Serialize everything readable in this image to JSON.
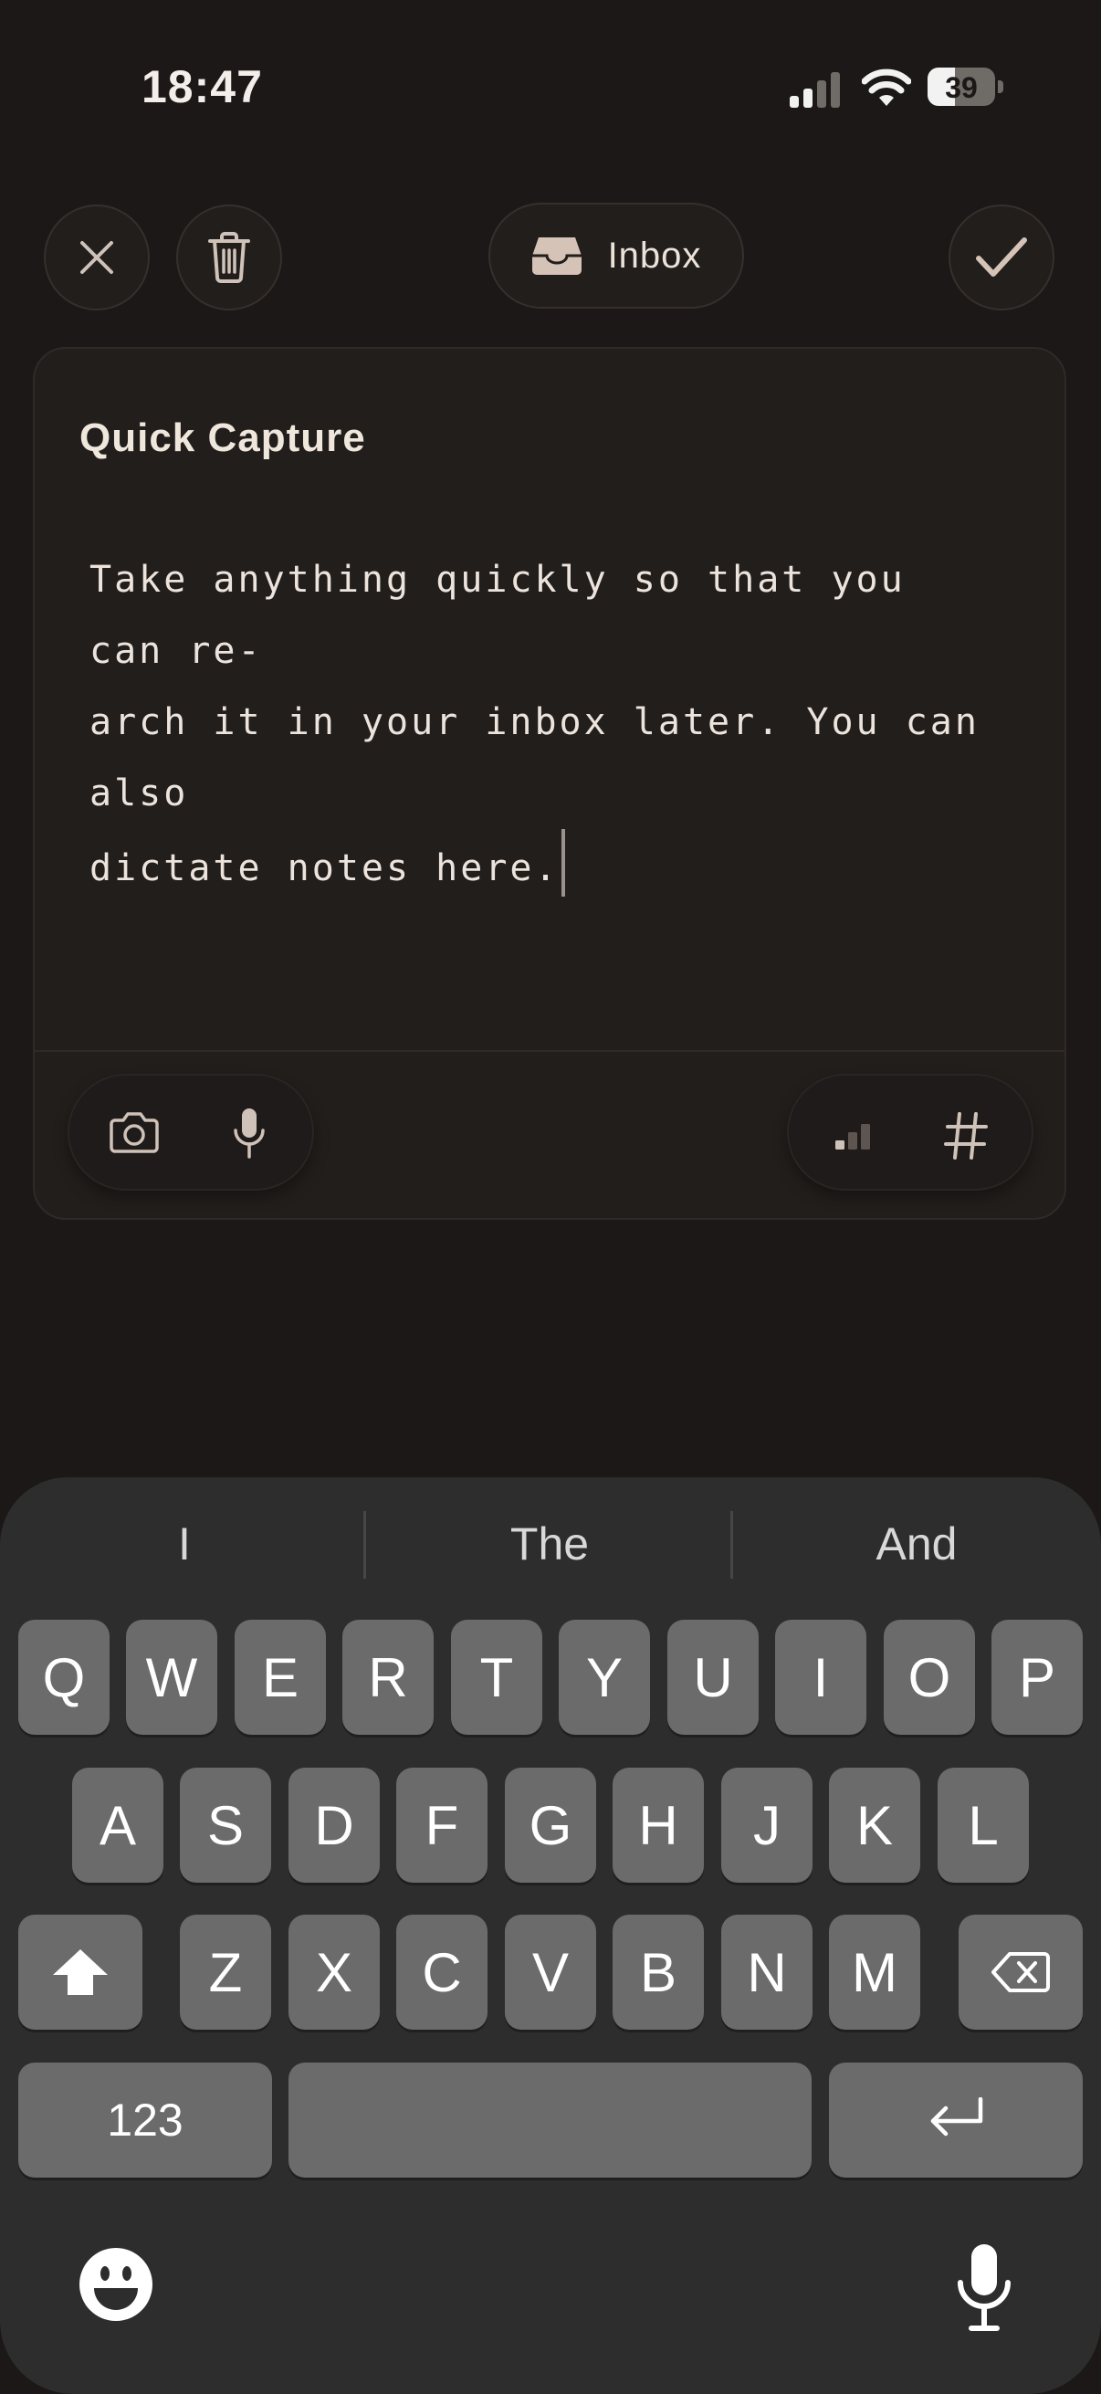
{
  "status_bar": {
    "time": "18:47",
    "battery": "39",
    "icons": [
      "cellular-signal-icon",
      "wifi-icon",
      "battery-icon"
    ]
  },
  "toolbar": {
    "close_icon": "close-icon",
    "delete_icon": "trash-icon",
    "destination_label": "Inbox",
    "destination_icon": "inbox-tray-icon",
    "confirm_icon": "checkmark-icon"
  },
  "card": {
    "title": "Quick Capture",
    "note_text": "Take anything quickly so that you can re-\narch it in your inbox later. You can also\ndictate notes here.",
    "tools_left": [
      "camera-icon",
      "microphone-icon"
    ],
    "tools_right": [
      "priority-icon",
      "hashtag-icon"
    ]
  },
  "keyboard": {
    "suggestions": [
      "I",
      "The",
      "And"
    ],
    "row1": [
      "Q",
      "W",
      "E",
      "R",
      "T",
      "Y",
      "U",
      "I",
      "O",
      "P"
    ],
    "row2": [
      "A",
      "S",
      "D",
      "F",
      "G",
      "H",
      "J",
      "K",
      "L"
    ],
    "row3": [
      "Z",
      "X",
      "C",
      "V",
      "B",
      "N",
      "M"
    ],
    "numbers_label": "123",
    "space_label": "",
    "colors": {
      "background": "#2d2d2d",
      "key": "#6b6b6b"
    }
  },
  "colors": {
    "app_background": "#1b1817",
    "card_background": "#221e1c",
    "accent_icon": "#d4c3b6"
  }
}
